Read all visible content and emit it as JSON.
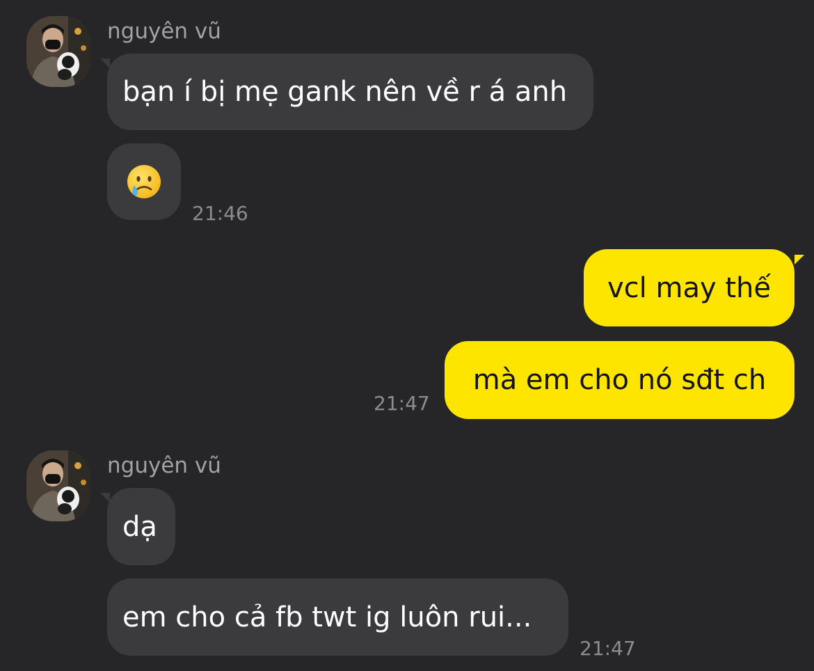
{
  "colors": {
    "background": "#262628",
    "incoming_bubble": "#3b3b3d",
    "outgoing_bubble": "#fee500",
    "outgoing_text": "#141414",
    "timestamp": "#8d8d91"
  },
  "messages": [
    {
      "sender": "nguyên vũ",
      "bubbles": [
        "bạn í bị mẹ gank nên về r á anh"
      ],
      "emoji_icon": "face-holding-back-tears-icon",
      "time": "21:46"
    },
    {
      "sender": "me",
      "bubbles": [
        "vcl may thế",
        "mà em cho nó sđt ch"
      ],
      "time": "21:47"
    },
    {
      "sender": "nguyên vũ",
      "bubbles": [
        "dạ",
        "em cho cả fb twt ig luôn rui..."
      ],
      "time": "21:47"
    }
  ]
}
